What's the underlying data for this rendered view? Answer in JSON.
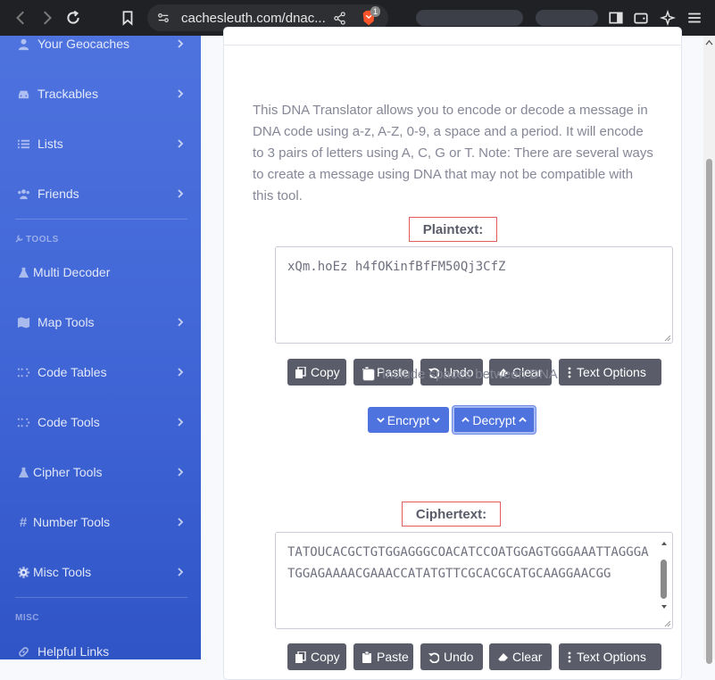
{
  "browser": {
    "url": "cachesleuth.com/dnac...",
    "shield_count": "1"
  },
  "sidebar": {
    "items_top": [
      {
        "label": "Your Geocaches",
        "icon": "user-icon"
      },
      {
        "label": "Trackables",
        "icon": "car-icon"
      },
      {
        "label": "Lists",
        "icon": "list-icon"
      },
      {
        "label": "Friends",
        "icon": "users-icon"
      }
    ],
    "tools_heading": "TOOLS",
    "tools": [
      {
        "label": "Multi Decoder",
        "icon": "flask-icon"
      },
      {
        "label": "Map Tools",
        "icon": "map-icon"
      },
      {
        "label": "Code Tables",
        "icon": "grid-icon"
      },
      {
        "label": "Code Tools",
        "icon": "grid-icon"
      },
      {
        "label": "Cipher Tools",
        "icon": "flask-icon"
      },
      {
        "label": "Number Tools",
        "icon": "hash-icon"
      },
      {
        "label": "Misc Tools",
        "icon": "gear-icon"
      }
    ],
    "misc_heading": "MISC",
    "misc": [
      {
        "label": "Helpful Links",
        "icon": "link-icon"
      }
    ]
  },
  "main": {
    "description": "This DNA Translator allows you to encode or decode a message in DNA code using a-z, A-Z, 0-9, a space and a period. It will encode to 3 pairs of letters using A, C, G or T. Note: There are several ways to create a message using DNA that may not be compatible with this tool.",
    "plaintext_label": "Plaintext:",
    "plaintext_value": "xQm.hoEz h4fOKinfBfFM50Qj3CfZ",
    "ciphertext_label": "Ciphertext:",
    "ciphertext_value": "TATOUCACGCTGTGGAGGGCOACATCCOATGGAGTGGGAAATTAGGGATGGAGAAAACGAAACCATATGTTCGCACGCATGCAAGGAACGG",
    "buttons": {
      "copy": "Copy",
      "paste": "Paste",
      "undo": "Undo",
      "clear": "Clear",
      "text_options": "Text Options"
    },
    "include_spaces_label": "Include spaces between DNA",
    "include_spaces_checked": false,
    "encrypt_label": "Encrypt",
    "decrypt_label": "Decrypt",
    "active_mode": "decrypt"
  },
  "colors": {
    "sidebar": "#4e73df",
    "primary": "#4e73df",
    "dark_button": "#5a5c69",
    "label_border": "#e25c5c"
  }
}
